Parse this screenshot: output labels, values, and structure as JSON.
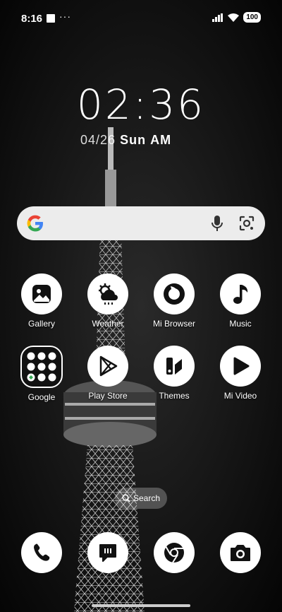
{
  "status_bar": {
    "time": "8:16",
    "dots": "···",
    "battery": "100"
  },
  "clock": {
    "time": "02:36",
    "date": "04/26",
    "day": "Sun",
    "ampm": "AM"
  },
  "apps": [
    {
      "label": "Gallery",
      "icon": "gallery-icon"
    },
    {
      "label": "Weather",
      "icon": "weather-icon"
    },
    {
      "label": "Mi Browser",
      "icon": "browser-icon"
    },
    {
      "label": "Music",
      "icon": "music-icon"
    },
    {
      "label": "Google",
      "icon": "google-folder-icon"
    },
    {
      "label": "Play Store",
      "icon": "play-store-icon"
    },
    {
      "label": "Themes",
      "icon": "themes-icon"
    },
    {
      "label": "Mi Video",
      "icon": "video-icon"
    }
  ],
  "search_pill": {
    "label": "Search"
  },
  "dock": [
    {
      "icon": "phone-icon"
    },
    {
      "icon": "messages-icon"
    },
    {
      "icon": "chrome-icon"
    },
    {
      "icon": "camera-icon"
    }
  ]
}
